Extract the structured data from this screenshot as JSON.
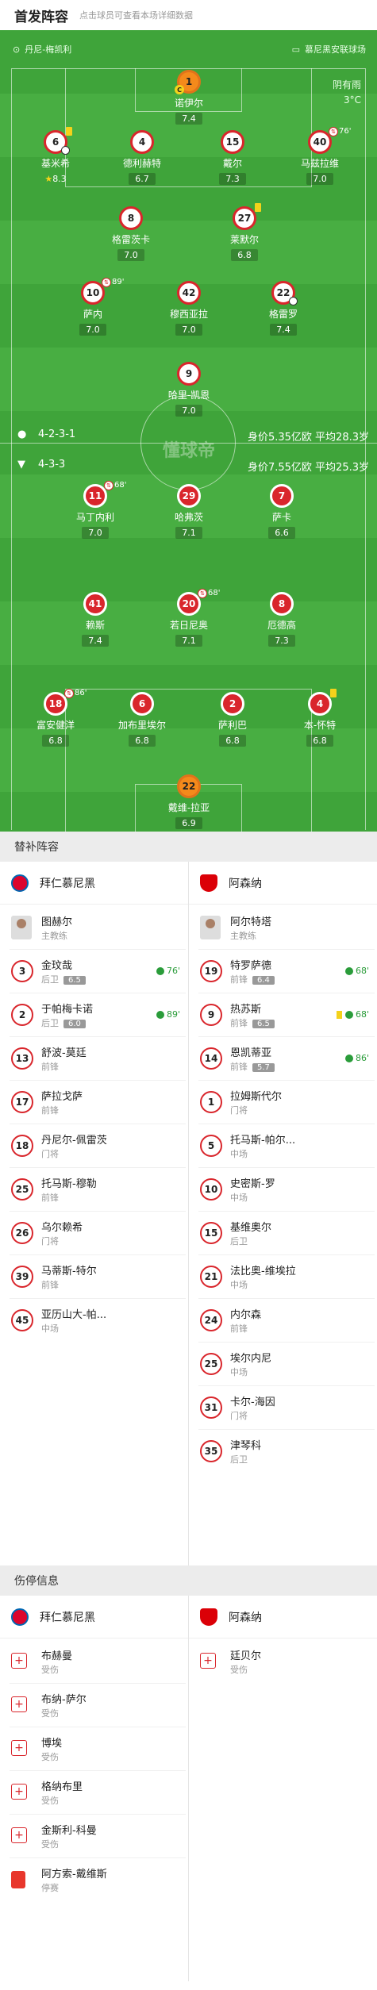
{
  "header": {
    "title": "首发阵容",
    "hint": "点击球员可查看本场详细数据"
  },
  "venue": {
    "home": "丹尼-梅凯利",
    "away": "慕尼黑安联球场"
  },
  "weather": {
    "condition": "阴有雨",
    "temp": "3°C"
  },
  "watermark": "懂球帝",
  "home_team": {
    "name": "拜仁慕尼黑",
    "formation": "4-2-3-1",
    "value": "身价5.35亿欧  平均28.3岁",
    "players": [
      {
        "num": "1",
        "name": "诺伊尔",
        "rating": "7.4"
      },
      {
        "num": "6",
        "name": "基米希",
        "rating": "8.3",
        "ev": ""
      },
      {
        "num": "4",
        "name": "德利赫特",
        "rating": "6.7"
      },
      {
        "num": "15",
        "name": "戴尔",
        "rating": "7.3"
      },
      {
        "num": "40",
        "name": "马兹拉维",
        "rating": "7.0",
        "ev": "76'"
      },
      {
        "num": "8",
        "name": "格雷茨卡",
        "rating": "7.0"
      },
      {
        "num": "27",
        "name": "莱默尔",
        "rating": "6.8"
      },
      {
        "num": "10",
        "name": "萨内",
        "rating": "7.0",
        "ev": "89'"
      },
      {
        "num": "42",
        "name": "穆西亚拉",
        "rating": "7.0"
      },
      {
        "num": "22",
        "name": "格雷罗",
        "rating": "7.4"
      },
      {
        "num": "9",
        "name": "哈里-凯恩",
        "rating": "7.0"
      }
    ]
  },
  "away_team": {
    "name": "阿森纳",
    "formation": "4-3-3",
    "value": "身价7.55亿欧  平均25.3岁",
    "players": [
      {
        "num": "11",
        "name": "马丁内利",
        "rating": "7.0",
        "ev": "68'"
      },
      {
        "num": "29",
        "name": "哈弗茨",
        "rating": "7.1"
      },
      {
        "num": "7",
        "name": "萨卡",
        "rating": "6.6"
      },
      {
        "num": "41",
        "name": "赖斯",
        "rating": "7.4"
      },
      {
        "num": "20",
        "name": "若日尼奥",
        "rating": "7.1",
        "ev": "68'"
      },
      {
        "num": "8",
        "name": "厄德高",
        "rating": "7.3"
      },
      {
        "num": "18",
        "name": "富安健洋",
        "rating": "6.8",
        "ev": "86'"
      },
      {
        "num": "6",
        "name": "加布里埃尔",
        "rating": "6.8"
      },
      {
        "num": "2",
        "name": "萨利巴",
        "rating": "6.8"
      },
      {
        "num": "4",
        "name": "本-怀特",
        "rating": "6.8"
      },
      {
        "num": "22",
        "name": "戴维-拉亚",
        "rating": "6.9"
      }
    ]
  },
  "subs": {
    "title": "替补阵容",
    "home": [
      {
        "name": "图赫尔",
        "pos": "主教练"
      },
      {
        "num": "3",
        "name": "金玟哉",
        "pos": "后卫",
        "rating": "6.5",
        "sub": "76'"
      },
      {
        "num": "2",
        "name": "于帕梅卡诺",
        "pos": "后卫",
        "rating": "6.0",
        "sub": "89'"
      },
      {
        "num": "13",
        "name": "舒波-莫廷",
        "pos": "前锋"
      },
      {
        "num": "17",
        "name": "萨拉戈萨",
        "pos": "前锋"
      },
      {
        "num": "18",
        "name": "丹尼尔-佩雷茨",
        "pos": "门将"
      },
      {
        "num": "25",
        "name": "托马斯-穆勒",
        "pos": "前锋"
      },
      {
        "num": "26",
        "name": "乌尔赖希",
        "pos": "门将"
      },
      {
        "num": "39",
        "name": "马蒂斯-特尔",
        "pos": "前锋"
      },
      {
        "num": "45",
        "name": "亚历山大-帕...",
        "pos": "中场"
      }
    ],
    "away": [
      {
        "name": "阿尔特塔",
        "pos": "主教练"
      },
      {
        "num": "19",
        "name": "特罗萨德",
        "pos": "前锋",
        "rating": "6.4",
        "sub": "68'"
      },
      {
        "num": "9",
        "name": "热苏斯",
        "pos": "前锋",
        "rating": "6.5",
        "sub": "68'"
      },
      {
        "num": "14",
        "name": "恩凯蒂亚",
        "pos": "前锋",
        "rating": "5.7",
        "sub": "86'"
      },
      {
        "num": "1",
        "name": "拉姆斯代尔",
        "pos": "门将"
      },
      {
        "num": "5",
        "name": "托马斯-帕尔...",
        "pos": "中场"
      },
      {
        "num": "10",
        "name": "史密斯-罗",
        "pos": "中场"
      },
      {
        "num": "15",
        "name": "基维奥尔",
        "pos": "后卫"
      },
      {
        "num": "21",
        "name": "法比奥-维埃拉",
        "pos": "中场"
      },
      {
        "num": "24",
        "name": "内尔森",
        "pos": "前锋"
      },
      {
        "num": "25",
        "name": "埃尔内尼",
        "pos": "中场"
      },
      {
        "num": "31",
        "name": "卡尔-海因",
        "pos": "门将"
      },
      {
        "num": "35",
        "name": "津琴科",
        "pos": "后卫"
      }
    ]
  },
  "injuries": {
    "title": "伤停信息",
    "home": [
      {
        "name": "布赫曼",
        "status": "受伤"
      },
      {
        "name": "布纳-萨尔",
        "status": "受伤"
      },
      {
        "name": "博埃",
        "status": "受伤"
      },
      {
        "name": "格纳布里",
        "status": "受伤"
      },
      {
        "name": "金斯利-科曼",
        "status": "受伤"
      },
      {
        "name": "阿方索-戴维斯",
        "status": "停赛"
      }
    ],
    "away": [
      {
        "name": "廷贝尔",
        "status": "受伤"
      }
    ]
  },
  "colors": {
    "pitch": "#3fa43a",
    "accent": "#d9262c",
    "section_bg": "#ececec"
  }
}
